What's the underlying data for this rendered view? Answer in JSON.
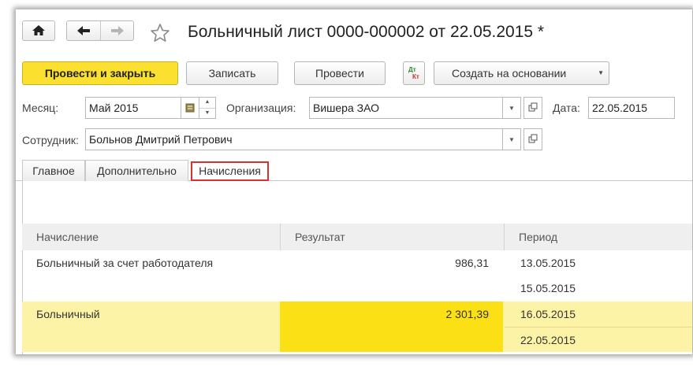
{
  "window": {
    "title": "Больничный лист 0000-000002 от 22.05.2015 *"
  },
  "toolbar": {
    "post_close_label": "Провести и закрыть",
    "save_label": "Записать",
    "post_label": "Провести",
    "dtkt_icon_text": "Дт Кт",
    "create_based_label": "Создать на основании"
  },
  "form": {
    "month_label": "Месяц:",
    "month_value": "Май 2015",
    "org_label": "Организация:",
    "org_value": "Вишера ЗАО",
    "date_label": "Дата:",
    "date_value": "22.05.2015",
    "employee_label": "Сотрудник:",
    "employee_value": "Больнов Дмитрий Петрович"
  },
  "tabs": [
    {
      "label": "Главное"
    },
    {
      "label": "Дополнительно"
    },
    {
      "label": "Начисления"
    }
  ],
  "table": {
    "columns": [
      "Начисление",
      "Результат",
      "Период"
    ],
    "rows": [
      {
        "name": "Больничный за счет работодателя",
        "result": "986,31",
        "period_start": "13.05.2015",
        "period_end": "15.05.2015",
        "selected": false
      },
      {
        "name": "Больничный",
        "result": "2 301,39",
        "period_start": "16.05.2015",
        "period_end": "22.05.2015",
        "selected": true
      }
    ]
  },
  "colors": {
    "primary_button": "#fbe030",
    "selected_row": "#fdf3a6",
    "selected_cell": "#fbe016",
    "active_tab_border": "#d9312b"
  },
  "icons": {
    "home": "home-icon",
    "back": "arrow-left-icon",
    "forward": "arrow-right-icon",
    "favorite": "star-icon",
    "dtkt": "dt-kt-icon",
    "dropdown": "chevron-down-icon",
    "open": "open-form-icon",
    "calendar": "calendar-icon"
  }
}
